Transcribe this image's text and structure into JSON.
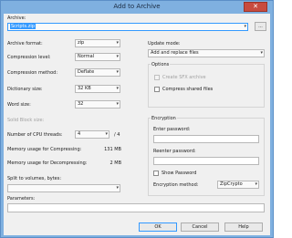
{
  "window": {
    "title": "Add to Archive",
    "close_label": "✕"
  },
  "archive": {
    "label": "Archive:",
    "value": "Scripts.zip",
    "browse_label": "..."
  },
  "left": {
    "archive_format": {
      "label": "Archive format:",
      "value": "zip"
    },
    "compression_level": {
      "label": "Compression level:",
      "value": "Normal"
    },
    "compression_method": {
      "label": "Compression method:",
      "value": "Deflate"
    },
    "dictionary_size": {
      "label": "Dictionary size:",
      "value": "32 KB"
    },
    "word_size": {
      "label": "Word size:",
      "value": "32"
    },
    "solid_block_size": {
      "label": "Solid Block size:"
    },
    "cpu_threads": {
      "label": "Number of CPU threads:",
      "value": "4",
      "max": "/ 4"
    },
    "memory_compress": {
      "label": "Memory usage for Compressing:",
      "value": "131 MB"
    },
    "memory_decompress": {
      "label": "Memory usage for Decompressing:",
      "value": "2 MB"
    },
    "split": {
      "label": "Split to volumes, bytes:"
    }
  },
  "right": {
    "update_mode": {
      "label": "Update mode:",
      "value": "Add and replace files"
    },
    "options": {
      "title": "Options",
      "sfx_label": "Create SFX archive",
      "compress_shared_label": "Compress shared files"
    },
    "encryption": {
      "title": "Encryption",
      "password_label": "Enter password:",
      "reenter_label": "Reenter password:",
      "show_password_label": "Show Password",
      "method_label": "Encryption method:",
      "method_value": "ZipCrypto"
    }
  },
  "parameters": {
    "label": "Parameters:"
  },
  "buttons": {
    "ok": "OK",
    "cancel": "Cancel",
    "help": "Help"
  },
  "icons": {
    "dropdown": "▾"
  }
}
